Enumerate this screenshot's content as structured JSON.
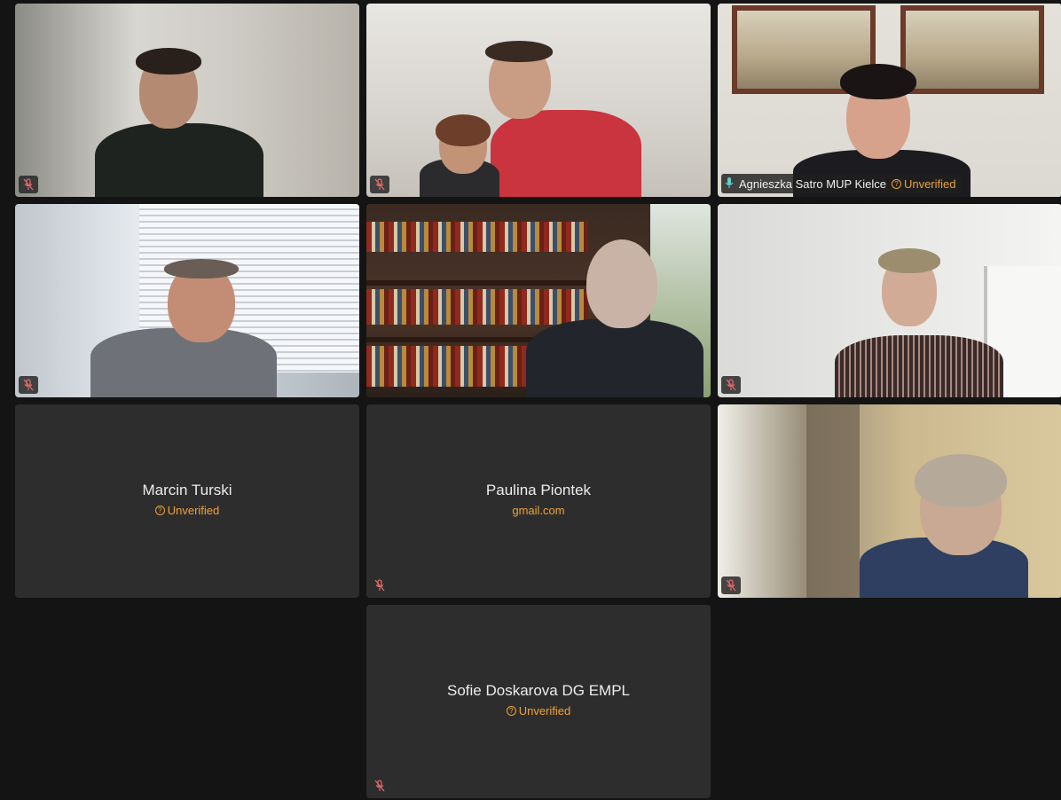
{
  "colors": {
    "background": "#141414",
    "tile_background": "#2d2d2d",
    "active_speaker_border": "#5fd3c8",
    "unverified_text": "#f0a23c",
    "mute_icon": "#e06a6a"
  },
  "tiles": [
    {
      "camera": "on",
      "muted": true
    },
    {
      "camera": "on",
      "muted": true
    },
    {
      "camera": "on",
      "speaking": true,
      "name": "Agnieszka Satro MUP Kielce",
      "status": "Unverified"
    },
    {
      "camera": "on",
      "muted": true
    },
    {
      "camera": "on",
      "muted": false
    },
    {
      "camera": "on",
      "muted": true
    },
    {
      "camera": "off",
      "name": "Marcin Turski",
      "status": "Unverified",
      "muted": false
    },
    {
      "camera": "off",
      "name": "Paulina Piontek",
      "status": "gmail.com",
      "muted": true
    },
    {
      "camera": "on",
      "muted": true
    },
    {
      "camera": "off",
      "name": "Sofie Doskarova DG EMPL",
      "status": "Unverified",
      "muted": true
    }
  ],
  "icons": {
    "muted_mic": "mic-off-icon",
    "active_mic": "mic-on-icon",
    "unverified": "question-circle-icon"
  }
}
